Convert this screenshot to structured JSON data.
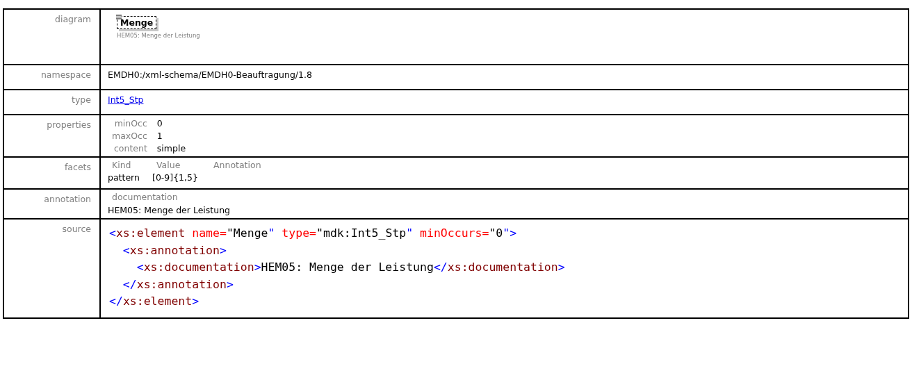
{
  "rows": [
    {
      "kind": "diagram",
      "label": "diagram",
      "element_name": "Menge",
      "caption": "HEM05: Menge der Leistung"
    },
    {
      "kind": "text",
      "label": "namespace",
      "value": "EMDH0:/xml-schema/EMDH0-Beauftragung/1.8"
    },
    {
      "kind": "link",
      "label": "type",
      "value": "Int5_Stp"
    },
    {
      "kind": "properties",
      "label": "properties",
      "items": [
        {
          "name": "minOcc",
          "value": "0"
        },
        {
          "name": "maxOcc",
          "value": "1"
        },
        {
          "name": "content",
          "value": "simple"
        }
      ]
    },
    {
      "kind": "facets",
      "label": "facets",
      "columns": [
        "Kind",
        "Value",
        "Annotation"
      ],
      "items": [
        {
          "kind": "pattern",
          "value": "[0-9]{1,5}"
        }
      ]
    },
    {
      "kind": "annotation",
      "label": "annotation",
      "heading": "documentation",
      "text": "HEM05: Menge der Leistung"
    },
    {
      "kind": "source",
      "label": "source",
      "lines": [
        {
          "tokens": [
            {
              "kind": "bracket",
              "text": "<"
            },
            {
              "kind": "tag",
              "text": "xs:element"
            },
            {
              "kind": "attr",
              "text": " name="
            },
            {
              "kind": "value",
              "text": "\"Menge"
            },
            {
              "kind": "bracket",
              "text": "\""
            },
            {
              "kind": "attr",
              "text": " type="
            },
            {
              "kind": "value",
              "text": "\"mdk:Int5_Stp"
            },
            {
              "kind": "bracket",
              "text": "\""
            },
            {
              "kind": "attr",
              "text": " minOccurs="
            },
            {
              "kind": "value",
              "text": "\"0"
            },
            {
              "kind": "bracket",
              "text": "\">"
            }
          ]
        },
        {
          "tokens": [
            {
              "kind": "bracket",
              "text": "  <"
            },
            {
              "kind": "tag",
              "text": "xs:annotation"
            },
            {
              "kind": "bracket",
              "text": ">"
            }
          ]
        },
        {
          "tokens": [
            {
              "kind": "bracket",
              "text": "    <"
            },
            {
              "kind": "tag",
              "text": "xs:documentation"
            },
            {
              "kind": "bracket",
              "text": ">"
            },
            {
              "kind": "value",
              "text": "HEM05: Menge der Leistung"
            },
            {
              "kind": "bracket",
              "text": "</"
            },
            {
              "kind": "tag",
              "text": "xs:documentation"
            },
            {
              "kind": "bracket",
              "text": ">"
            }
          ]
        },
        {
          "tokens": [
            {
              "kind": "bracket",
              "text": "  </"
            },
            {
              "kind": "tag",
              "text": "xs:annotation"
            },
            {
              "kind": "bracket",
              "text": ">"
            }
          ]
        },
        {
          "tokens": [
            {
              "kind": "bracket",
              "text": "</"
            },
            {
              "kind": "tag",
              "text": "xs:element"
            },
            {
              "kind": "bracket",
              "text": ">"
            }
          ]
        }
      ]
    }
  ]
}
